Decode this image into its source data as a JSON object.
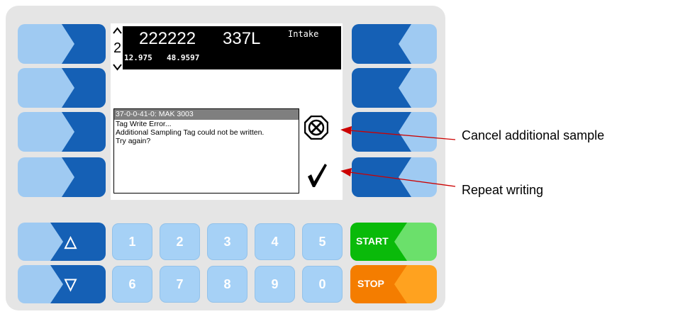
{
  "status": {
    "arrow_up": "^",
    "compartment": "2",
    "arrow_down": "v",
    "id_value": "222222",
    "volume": "337L",
    "mode": "Intake",
    "coord_a": "12.975",
    "coord_b": "48.9597"
  },
  "dialog": {
    "title": "37-0-0-41-0: MAK 3003",
    "lines": [
      "Tag Write Error...",
      "Additional Sampling Tag could not be written.",
      "Try again?"
    ]
  },
  "softkeys": {
    "cancel_icon": "cancel-x-icon",
    "confirm_icon": "checkmark-icon"
  },
  "keypad": {
    "digits_top": [
      "1",
      "2",
      "3",
      "4",
      "5"
    ],
    "digits_bottom": [
      "6",
      "7",
      "8",
      "9",
      "0"
    ],
    "up_symbol": "△",
    "down_symbol": "▽",
    "start_label": "START",
    "stop_label": "STOP"
  },
  "callouts": {
    "cancel": "Cancel additional sample",
    "repeat": "Repeat writing"
  },
  "colors": {
    "key_light": "#9fcaf2",
    "key_dark": "#1560b5",
    "start_green": "#0aba0a",
    "stop_orange": "#f47d00",
    "panel": "#e5e5e5",
    "callout_arrow": "#cc0000"
  }
}
